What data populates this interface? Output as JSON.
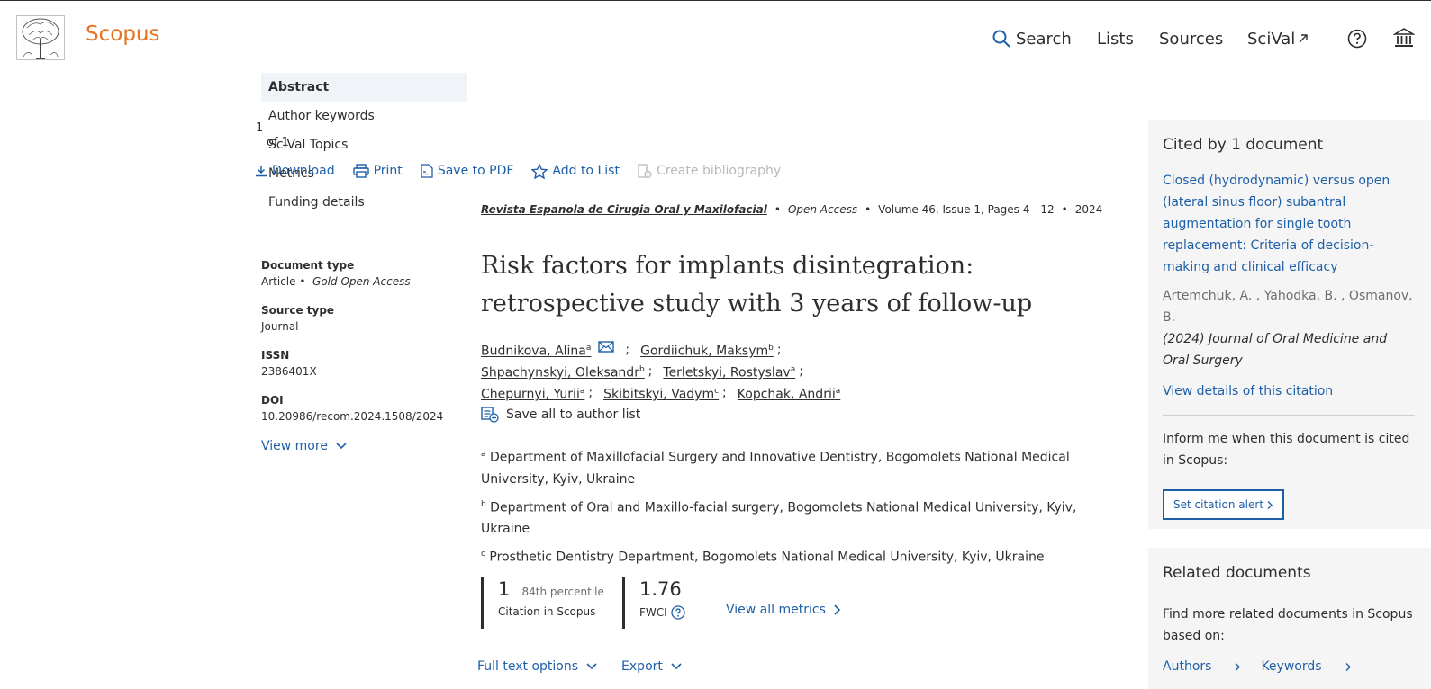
{
  "header": {
    "brand": "Scopus",
    "nav": {
      "search": "Search",
      "lists": "Lists",
      "sources": "Sources",
      "scival": "SciVal"
    },
    "icons": [
      "search-icon",
      "external-link-icon",
      "help-icon",
      "institution-icon"
    ]
  },
  "outline": {
    "items": [
      "Abstract",
      "Author keywords",
      "SciVal Topics",
      "Metrics",
      "Funding details"
    ],
    "pager": [
      "1",
      "of 1"
    ]
  },
  "toolbar": {
    "download": "Download",
    "print": "Print",
    "save_pdf": "Save to PDF",
    "add_list": "Add to List",
    "create_bib": "Create bibliography"
  },
  "meta": {
    "doc_type_label": "Document type",
    "doc_type": "Article",
    "doc_access": "Gold Open Access",
    "source_type_label": "Source type",
    "source_type": "Journal",
    "issn_label": "ISSN",
    "issn": "2386401X",
    "doi_label": "DOI",
    "doi": "10.20986/recom.2024.1508/2024",
    "view_more": "View more"
  },
  "main": {
    "journal": "Revista Espanola de Cirugia Oral y Maxilofacial",
    "access": "Open Access",
    "volume": "Volume 46, Issue 1, Pages 4 - 12",
    "year": "2024",
    "title": "Risk factors for implants disintegration: retrospective study with 3 years of follow-up",
    "authors": [
      {
        "name": "Budnikova, Alina",
        "sup": "a"
      },
      {
        "name": "Gordiichuk, Maksym",
        "sup": "b"
      },
      {
        "name": "Shpachynskyi, Oleksandr",
        "sup": "b"
      },
      {
        "name": "Terletskyi, Rostyslav",
        "sup": "a"
      },
      {
        "name": "Chepurnyi, Yurii",
        "sup": "a"
      },
      {
        "name": "Skibitskyi, Vadym",
        "sup": "c"
      },
      {
        "name": "Kopchak, Andrii",
        "sup": "a"
      }
    ],
    "save_authors": "Save all to author list",
    "affiliations": [
      {
        "sup": "a",
        "text": "Department of Maxillofacial Surgery and Innovative Dentistry, Bogomolets National Medical University, Kyiv, Ukraine"
      },
      {
        "sup": "b",
        "text": "Department of Oral and Maxillo-facial surgery, Bogomolets National Medical University, Kyiv, Ukraine"
      },
      {
        "sup": "c",
        "text": "Prosthetic Dentistry Department, Bogomolets National Medical University, Kyiv, Ukraine"
      }
    ]
  },
  "metrics": {
    "citations": "1",
    "percentile": "84th percentile",
    "citations_label": "Citation in Scopus",
    "fwci": "1.76",
    "fwci_label": "FWCI",
    "view_all": "View all metrics"
  },
  "actions": {
    "full_text": "Full text options",
    "export": "Export"
  },
  "cited": {
    "title": "Cited by 1 document",
    "doc_title": "Closed (hydrodynamic) versus open (lateral sinus floor) subantral augmentation for single tooth replacement: Criteria of decision-making and clinical efficacy",
    "doc_authors": "Artemchuk, A. , Yahodka, B. , Osmanov, B.",
    "doc_source": "(2024) Journal of Oral Medicine and Oral Surgery",
    "view_details": "View details of this citation",
    "inform": "Inform me when this document is cited in Scopus:",
    "alert_btn": "Set citation alert"
  },
  "related": {
    "title": "Related documents",
    "text": "Find more related documents in Scopus based on:",
    "authors": "Authors",
    "keywords": "Keywords"
  },
  "colors": {
    "brand": "#e9711c",
    "link": "#1f5fa8",
    "text": "#2e2e2e",
    "panel": "#f5f5f5"
  }
}
